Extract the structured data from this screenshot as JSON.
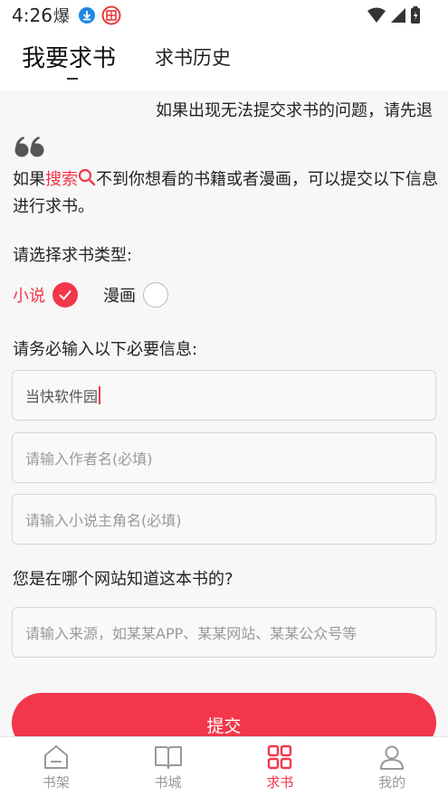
{
  "status_bar": {
    "time": "4:26"
  },
  "header": {
    "tabs": [
      {
        "label": "我要求书"
      },
      {
        "label": "求书历史"
      }
    ]
  },
  "notice": "如果出现无法提交求书的问题，请先退",
  "intro": {
    "prefix": "如果",
    "highlight": "搜索",
    "suffix": "不到你想看的书籍或者漫画，可以提交以下信息进行求书。"
  },
  "type_section": {
    "label": "请选择求书类型:",
    "options": [
      {
        "label": "小说",
        "selected": true
      },
      {
        "label": "漫画",
        "selected": false
      }
    ]
  },
  "required_label": "请务必输入以下必要信息:",
  "fields": {
    "book_name_value": "当快软件园",
    "author_placeholder": "请输入作者名(必填)",
    "protagonist_placeholder": "请输入小说主角名(必填)"
  },
  "source_section": {
    "label": "您是在哪个网站知道这本书的?",
    "placeholder": "请输入来源，如某某APP、某某网站、某某公众号等"
  },
  "submit_label": "提交",
  "bottom_nav": [
    {
      "label": "书架",
      "icon": "house-icon"
    },
    {
      "label": "书城",
      "icon": "book-icon"
    },
    {
      "label": "求书",
      "icon": "grid-icon",
      "active": true
    },
    {
      "label": "我的",
      "icon": "person-icon"
    }
  ],
  "colors": {
    "accent": "#f2374a"
  }
}
